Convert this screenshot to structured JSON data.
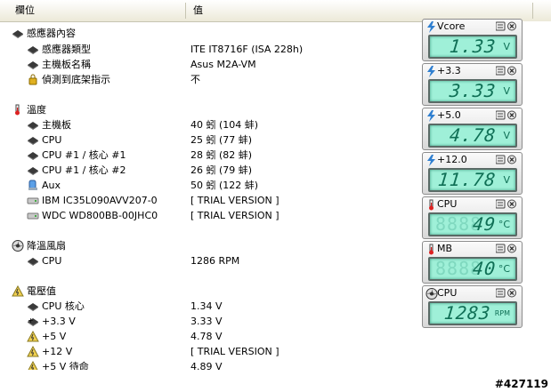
{
  "header": {
    "col_field": "欄位",
    "col_value": "值"
  },
  "rows": [
    {
      "label": "感應器內容",
      "value": "",
      "icon": "sensor-group-icon",
      "kind": "group"
    },
    {
      "label": "感應器類型",
      "value": "ITE IT8716F  (ISA 228h)",
      "icon": "sensor-chip-icon",
      "kind": "item"
    },
    {
      "label": "主機板名稱",
      "value": "Asus M2A-VM",
      "icon": "motherboard-icon",
      "kind": "item"
    },
    {
      "label": "偵測到底架指示",
      "value": "不",
      "icon": "chassis-lock-icon",
      "kind": "item"
    },
    {
      "label": "",
      "value": "",
      "icon": "",
      "kind": "spacer"
    },
    {
      "label": "溫度",
      "value": "",
      "icon": "thermometer-icon",
      "kind": "group"
    },
    {
      "label": "主機板",
      "value": "40 蚓  (104 蚌)",
      "icon": "board-chip-icon",
      "kind": "item"
    },
    {
      "label": "CPU",
      "value": "25 蚓  (77 蚌)",
      "icon": "cpu-icon",
      "kind": "item"
    },
    {
      "label": "CPU #1 / 核心 #1",
      "value": "28 蚓  (82 蚌)",
      "icon": "cpu-icon",
      "kind": "item"
    },
    {
      "label": "CPU #1 / 核心 #2",
      "value": "26 蚓  (79 蚌)",
      "icon": "cpu-icon",
      "kind": "item"
    },
    {
      "label": "Aux",
      "value": "50 蚓  (122 蚌)",
      "icon": "aux-sensor-icon",
      "kind": "item"
    },
    {
      "label": "IBM IC35L090AVV207-0",
      "value": "[ TRIAL VERSION ]",
      "icon": "hard-drive-icon",
      "kind": "item"
    },
    {
      "label": "WDC WD800BB-00JHC0",
      "value": "[ TRIAL VERSION ]",
      "icon": "hard-drive-icon",
      "kind": "item"
    },
    {
      "label": "",
      "value": "",
      "icon": "",
      "kind": "spacer"
    },
    {
      "label": "降溫風扇",
      "value": "",
      "icon": "fan-icon",
      "kind": "group"
    },
    {
      "label": "CPU",
      "value": "1286 RPM",
      "icon": "cpu-icon",
      "kind": "item"
    },
    {
      "label": "",
      "value": "",
      "icon": "",
      "kind": "spacer"
    },
    {
      "label": "電壓值",
      "value": "",
      "icon": "voltage-icon",
      "kind": "group"
    },
    {
      "label": "CPU 核心",
      "value": "1.34 V",
      "icon": "cpu-icon",
      "kind": "item"
    },
    {
      "label": "+3.3 V",
      "value": "3.33 V",
      "icon": "plus-chip-icon",
      "kind": "item"
    },
    {
      "label": "+5 V",
      "value": "4.78 V",
      "icon": "voltage-small-icon",
      "kind": "item"
    },
    {
      "label": "+12 V",
      "value": "[ TRIAL VERSION ]",
      "icon": "voltage-small-icon",
      "kind": "item"
    },
    {
      "label": "+5 V 待命",
      "value": "4.89 V",
      "icon": "voltage-small-icon",
      "kind": "item"
    }
  ],
  "gadgets": [
    {
      "title": "Vcore",
      "digits": "1.33",
      "ghost": "",
      "unit": "V",
      "icon": "bolt-icon"
    },
    {
      "title": "+3.3",
      "digits": "3.33",
      "ghost": "",
      "unit": "V",
      "icon": "bolt-icon"
    },
    {
      "title": "+5.0",
      "digits": "4.78",
      "ghost": "",
      "unit": "V",
      "icon": "bolt-icon"
    },
    {
      "title": "+12.0",
      "digits": "11.78",
      "ghost": "",
      "unit": "V",
      "icon": "bolt-icon"
    },
    {
      "title": "CPU",
      "digits": "49",
      "ghost": "8888",
      "unit": "°C",
      "icon": "thermometer-icon"
    },
    {
      "title": "MB",
      "digits": "40",
      "ghost": "8888",
      "unit": "°C",
      "icon": "thermometer-icon"
    },
    {
      "title": "CPU",
      "digits": "1283",
      "ghost": "",
      "unit": "RPM",
      "icon": "fan-icon"
    }
  ],
  "watermark": "#427119",
  "colors": {
    "lcd_bg": "#9ff0d8",
    "lcd_digit": "#0f6f55",
    "header_bg": "#ece9d8"
  }
}
